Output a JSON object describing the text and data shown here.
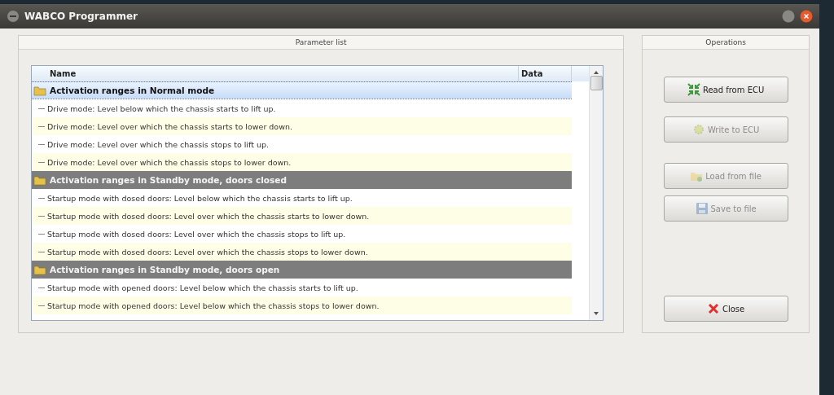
{
  "window": {
    "title": "WABCO Programmer"
  },
  "parameter_list": {
    "title": "Parameter list",
    "columns": [
      "Name",
      "Data"
    ],
    "groups": [
      {
        "label": "Activation ranges in Normal mode",
        "selected": true,
        "children": [
          {
            "label": "Drive mode: Level below which the chassis starts to lift up."
          },
          {
            "label": "Drive mode: Level over which the chassis starts to lower down."
          },
          {
            "label": "Drive mode: Level over which the chassis stops to lift up."
          },
          {
            "label": "Drive mode: Level over which the chassis stops to lower down."
          }
        ]
      },
      {
        "label": "Activation ranges in Standby mode, doors closed",
        "selected": false,
        "children": [
          {
            "label": "Startup mode with dosed doors: Level below which the chassis starts to lift up."
          },
          {
            "label": "Startup mode with dosed doors: Level over which the chassis starts to lower down."
          },
          {
            "label": "Startup mode with dosed doors: Level over which the chassis stops to lift up."
          },
          {
            "label": "Startup mode with dosed doors: Level over which the chassis stops to lower down."
          }
        ]
      },
      {
        "label": "Activation ranges in Standby mode, doors open",
        "selected": false,
        "children": [
          {
            "label": "Startup mode with opened doors: Level below which the chassis starts to lift up."
          },
          {
            "label": "Startup mode with opened doors: Level below which the chassis stops to lower down."
          }
        ]
      }
    ]
  },
  "operations": {
    "title": "Operations",
    "buttons": [
      {
        "kind": "read",
        "label": "Read from ECU",
        "disabled": false
      },
      {
        "kind": "write",
        "label": "Write to ECU",
        "disabled": true
      },
      {
        "kind": "load",
        "label": "Load from file",
        "disabled": true
      },
      {
        "kind": "save",
        "label": "Save to file",
        "disabled": true
      },
      {
        "kind": "close",
        "label": "Close",
        "disabled": false
      }
    ]
  }
}
